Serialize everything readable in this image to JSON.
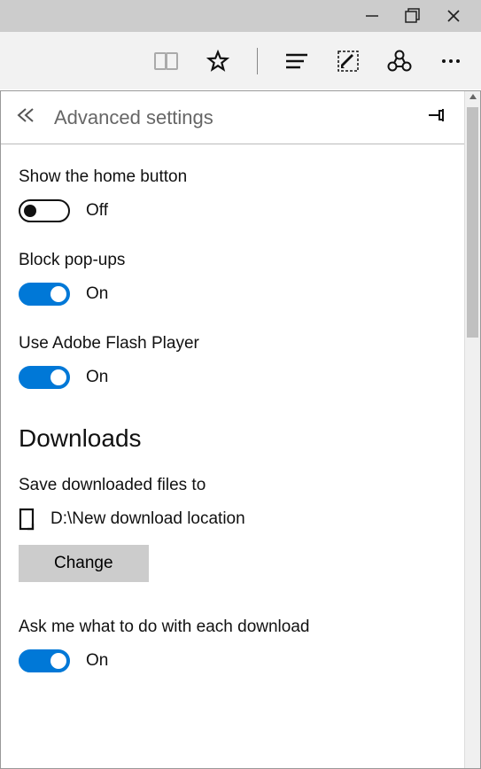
{
  "window": {
    "minimize": "—",
    "maximize": "❐",
    "close": "✕"
  },
  "panel": {
    "title": "Advanced settings"
  },
  "settings": {
    "home_button": {
      "label": "Show the home button",
      "state": "Off"
    },
    "block_popups": {
      "label": "Block pop-ups",
      "state": "On"
    },
    "flash": {
      "label": "Use Adobe Flash Player",
      "state": "On"
    }
  },
  "downloads": {
    "heading": "Downloads",
    "save_to_label": "Save downloaded files to",
    "path": "D:\\New download location",
    "change_button": "Change",
    "ask_label": "Ask me what to do with each download",
    "ask_state": "On"
  }
}
